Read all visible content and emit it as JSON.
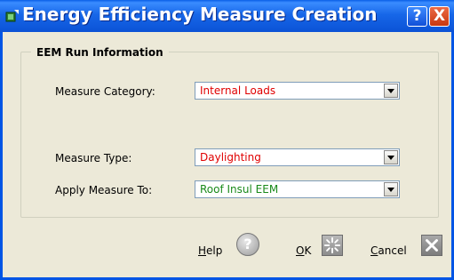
{
  "window": {
    "title": "Energy Efficiency Measure Creation",
    "help_button": "?",
    "close_button": "X"
  },
  "group": {
    "legend": "EEM Run Information"
  },
  "fields": {
    "measure_category": {
      "label": "Measure Category:",
      "value": "Internal Loads"
    },
    "measure_type": {
      "label": "Measure Type:",
      "value": "Daylighting"
    },
    "apply_measure_to": {
      "label": "Apply Measure To:",
      "value": "Roof Insul EEM"
    }
  },
  "buttons": {
    "help": {
      "label_u": "H",
      "label_rest": "elp",
      "icon_glyph": "?"
    },
    "ok": {
      "label_u": "O",
      "label_rest": "K"
    },
    "cancel": {
      "label_u": "C",
      "label_rest": "ancel"
    }
  },
  "colors": {
    "title_bar": "#0a5fe6",
    "dialog_bg": "#ece9d8",
    "value_red": "#e00000",
    "value_green": "#1a8a1a"
  },
  "icons": {
    "app": "app-icon",
    "help": "help-circle-icon",
    "ok": "ok-sparkle-icon",
    "cancel": "cancel-x-icon"
  }
}
